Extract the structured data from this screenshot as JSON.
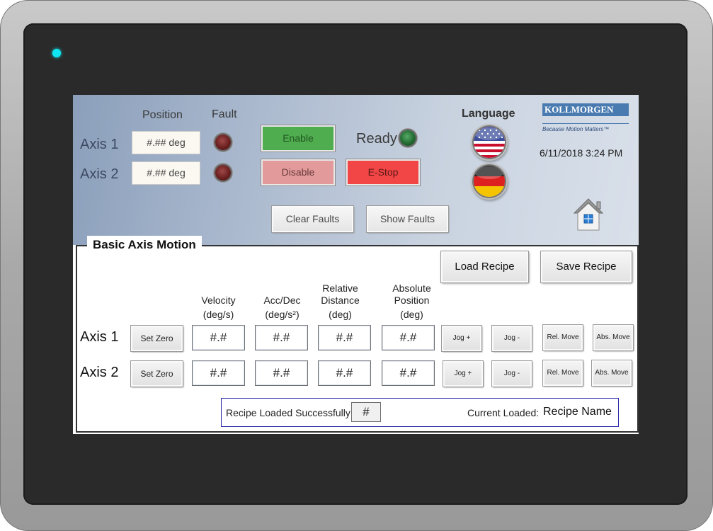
{
  "header": {
    "position_label": "Position",
    "fault_label": "Fault",
    "axis1_label": "Axis 1",
    "axis2_label": "Axis 2",
    "axis1_position": "#.## deg",
    "axis2_position": "#.## deg",
    "enable_label": "Enable",
    "disable_label": "Disable",
    "estop_label": "E-Stop",
    "ready_label": "Ready",
    "clear_faults_label": "Clear Faults",
    "show_faults_label": "Show Faults",
    "language_label": "Language",
    "datetime": "6/11/2018 3:24 PM",
    "logo_text": "KOLLMORGEN",
    "logo_tagline": "Because Motion Matters™"
  },
  "motion": {
    "title": "Basic Axis Motion",
    "load_recipe_label": "Load Recipe",
    "save_recipe_label": "Save Recipe",
    "columns": {
      "velocity": [
        "Velocity",
        "(deg/s)"
      ],
      "accdec": [
        "Acc/Dec",
        "(deg/s²)"
      ],
      "relative": [
        "Relative",
        "Distance",
        "(deg)"
      ],
      "absolute": [
        "Absolute",
        "Position",
        "(deg)"
      ]
    },
    "rows": [
      {
        "label": "Axis 1",
        "set_zero": "Set Zero",
        "velocity": "#.#",
        "accdec": "#.#",
        "relative": "#.#",
        "absolute": "#.#",
        "jog_plus": "Jog +",
        "jog_minus": "Jog -",
        "rel_move": "Rel. Move",
        "abs_move": "Abs. Move"
      },
      {
        "label": "Axis 2",
        "set_zero": "Set Zero",
        "velocity": "#.#",
        "accdec": "#.#",
        "relative": "#.#",
        "absolute": "#.#",
        "jog_plus": "Jog +",
        "jog_minus": "Jog -",
        "rel_move": "Rel. Move",
        "abs_move": "Abs. Move"
      }
    ],
    "status": {
      "message": "Recipe Loaded Successfully",
      "value": "#",
      "current_label": "Current Loaded:",
      "recipe_name": "Recipe Name"
    }
  },
  "colors": {
    "led_cyan": "#10e6f2",
    "enable_green": "#4fad4f",
    "disable_pink": "#e29a9a",
    "estop_red": "#f24545",
    "logo_blue": "#4a7bb0"
  }
}
